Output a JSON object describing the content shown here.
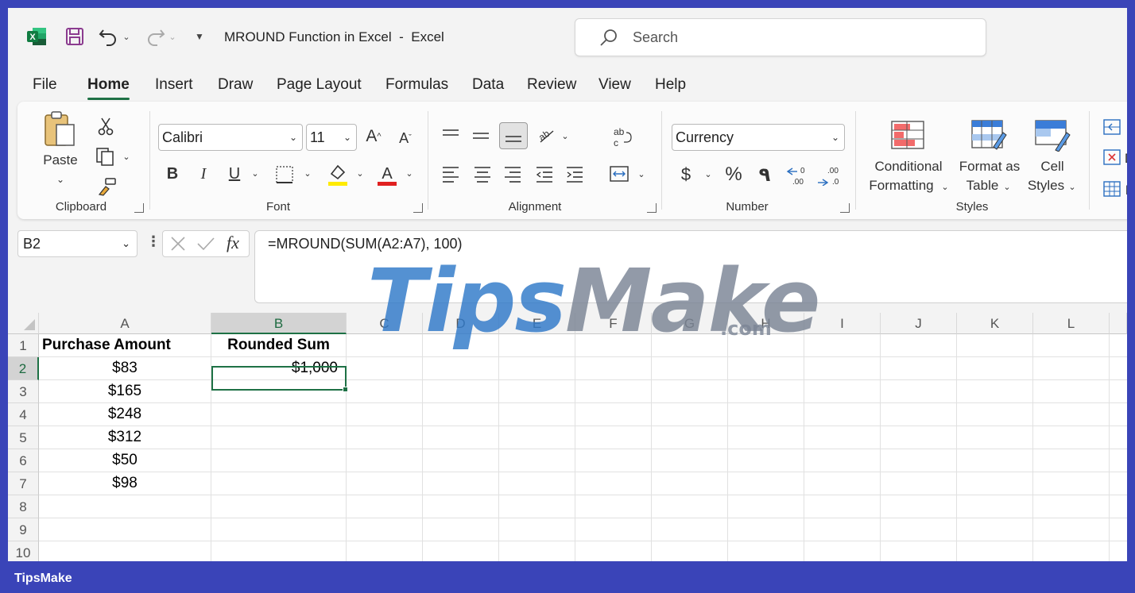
{
  "window": {
    "title": "MROUND Function in Excel",
    "app": "Excel",
    "title_separator": "-"
  },
  "search": {
    "placeholder": "Search"
  },
  "tabs": [
    "File",
    "Home",
    "Insert",
    "Draw",
    "Page Layout",
    "Formulas",
    "Data",
    "Review",
    "View",
    "Help"
  ],
  "active_tab": "Home",
  "ribbon": {
    "clipboard": {
      "label": "Clipboard",
      "paste": "Paste"
    },
    "font": {
      "label": "Font",
      "font_name": "Calibri",
      "font_size": "11"
    },
    "alignment": {
      "label": "Alignment"
    },
    "number": {
      "label": "Number",
      "format": "Currency"
    },
    "styles": {
      "label": "Styles",
      "conditional_l1": "Conditional",
      "conditional_l2": "Formatting",
      "format_table_l1": "Format as",
      "format_table_l2": "Table",
      "cell_styles_l1": "Cell",
      "cell_styles_l2": "Styles"
    },
    "cells_partial": [
      "I",
      "D",
      "F"
    ]
  },
  "formula_bar": {
    "name_box": "B2",
    "formula": "=MROUND(SUM(A2:A7), 100)",
    "fx": "fx"
  },
  "grid": {
    "columns": [
      "A",
      "B",
      "C",
      "D",
      "E",
      "F",
      "G",
      "H",
      "I",
      "J",
      "K",
      "L"
    ],
    "selected_column": "B",
    "selected_row": "2",
    "rows": [
      {
        "num": "1",
        "a": "Purchase Amount",
        "b": "Rounded Sum"
      },
      {
        "num": "2",
        "a": "$83",
        "b": "$1,000"
      },
      {
        "num": "3",
        "a": "$165",
        "b": ""
      },
      {
        "num": "4",
        "a": "$248",
        "b": ""
      },
      {
        "num": "5",
        "a": "$312",
        "b": ""
      },
      {
        "num": "6",
        "a": "$50",
        "b": ""
      },
      {
        "num": "7",
        "a": "$98",
        "b": ""
      },
      {
        "num": "8",
        "a": "",
        "b": ""
      },
      {
        "num": "9",
        "a": "",
        "b": ""
      },
      {
        "num": "10",
        "a": "",
        "b": ""
      }
    ]
  },
  "watermark": {
    "part1": "Tips",
    "part2": "Make",
    "domain": ".com"
  },
  "footer": {
    "brand": "TipsMake"
  },
  "colors": {
    "accent": "#1e7145",
    "frame": "#3a44b8"
  }
}
